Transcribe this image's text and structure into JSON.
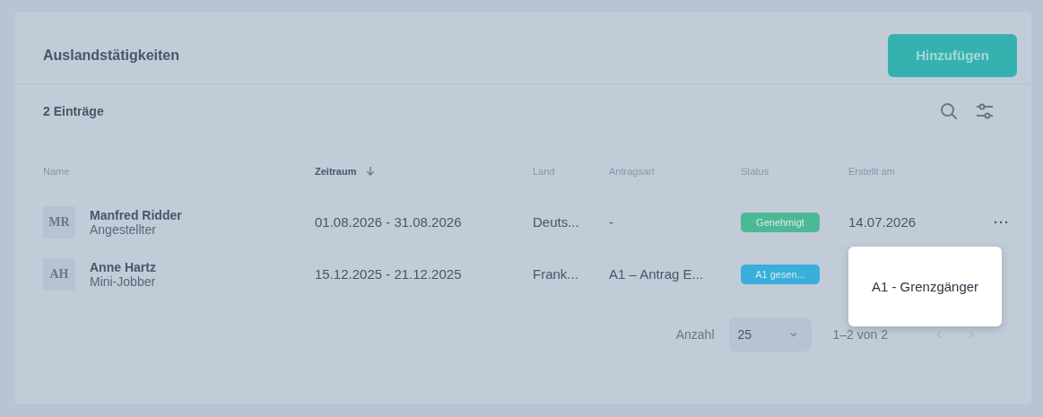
{
  "title": "Auslandstätigkeiten",
  "add_button": "Hinzufügen",
  "count": "2 Einträge",
  "columns": [
    {
      "label": "Name",
      "sorted": false
    },
    {
      "label": "Zeitraum",
      "sorted": true
    },
    {
      "label": "Land",
      "sorted": false
    },
    {
      "label": "Antragsart",
      "sorted": false
    },
    {
      "label": "Status",
      "sorted": false
    },
    {
      "label": "Erstellt am",
      "sorted": false
    }
  ],
  "rows": [
    {
      "initials": "MR",
      "name": "Manfred Ridder",
      "role": "Angestellter",
      "period": "01.08.2026 - 31.08.2026",
      "country": "Deuts...",
      "request_type": "-",
      "status": {
        "label": "Genehmigt",
        "color": "#4db895"
      },
      "created": "14.07.2026",
      "menu": "···"
    },
    {
      "initials": "AH",
      "name": "Anne Hartz",
      "role": "Mini-Jobber",
      "period": "15.12.2025 - 21.12.2025",
      "country": "Frank...",
      "request_type": "A1 – Antrag E...",
      "status": {
        "label": "A1 gesen...",
        "color": "#3aaedb"
      }
    }
  ],
  "tooltip": "A1 - Grenzgänger",
  "pagination": {
    "label": "Anzahl",
    "page_size": "25",
    "range": "1–2 von 2",
    "prev_disabled": true,
    "next_disabled": true
  }
}
